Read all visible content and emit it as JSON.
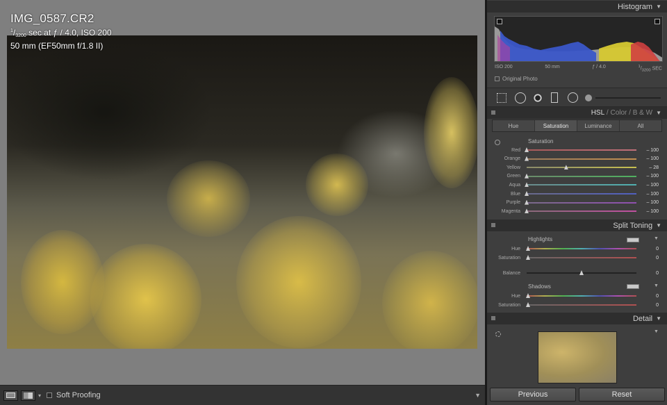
{
  "photo_info": {
    "filename": "IMG_0587.CR2",
    "shutter_num": "1",
    "shutter_den": "3200",
    "exposure_rest": " sec at ƒ / 4.0, ISO 200",
    "lens": "50 mm (EF50mm f/1.8 II)"
  },
  "toolbar": {
    "soft_proofing": "Soft Proofing"
  },
  "histogram": {
    "title": "Histogram",
    "iso": "ISO 200",
    "focal": "50 mm",
    "aperture": "ƒ / 4.0",
    "shutter_num": "1",
    "shutter_den": "3200",
    "shutter_unit": "SEC",
    "original_photo": "Original Photo"
  },
  "hsl": {
    "header_hsl": "HSL",
    "header_sep": " / ",
    "header_color": "Color",
    "header_bw": "B & W",
    "tabs": [
      "Hue",
      "Saturation",
      "Luminance",
      "All"
    ],
    "active_tab": "Saturation",
    "section": "Saturation",
    "sliders": [
      {
        "label": "Red",
        "value": "– 100",
        "level": -100,
        "color_a": "#a85a5a",
        "color_b": "#c0707a"
      },
      {
        "label": "Orange",
        "value": "– 100",
        "level": -100,
        "color_a": "#9a7a5a",
        "color_b": "#c49050"
      },
      {
        "label": "Yellow",
        "value": "– 28",
        "level": -28,
        "color_a": "#8a8a6a",
        "color_b": "#c8c050"
      },
      {
        "label": "Green",
        "value": "– 100",
        "level": -100,
        "color_a": "#6a8a6a",
        "color_b": "#50b060"
      },
      {
        "label": "Aqua",
        "value": "– 100",
        "level": -100,
        "color_a": "#6a8a8a",
        "color_b": "#50b0b0"
      },
      {
        "label": "Blue",
        "value": "– 100",
        "level": -100,
        "color_a": "#6a6a8a",
        "color_b": "#5060c0"
      },
      {
        "label": "Purple",
        "value": "– 100",
        "level": -100,
        "color_a": "#7a6a8a",
        "color_b": "#9050b0"
      },
      {
        "label": "Magenta",
        "value": "– 100",
        "level": -100,
        "color_a": "#8a6a7a",
        "color_b": "#c050a0"
      }
    ]
  },
  "split_toning": {
    "title": "Split Toning",
    "highlights": "Highlights",
    "shadows": "Shadows",
    "hue": "Hue",
    "saturation": "Saturation",
    "balance": "Balance",
    "hl_hue": "0",
    "hl_sat": "0",
    "balance_val": "0",
    "sh_hue": "0",
    "sh_sat": "0"
  },
  "detail": {
    "title": "Detail"
  },
  "buttons": {
    "previous": "Previous",
    "reset": "Reset"
  }
}
